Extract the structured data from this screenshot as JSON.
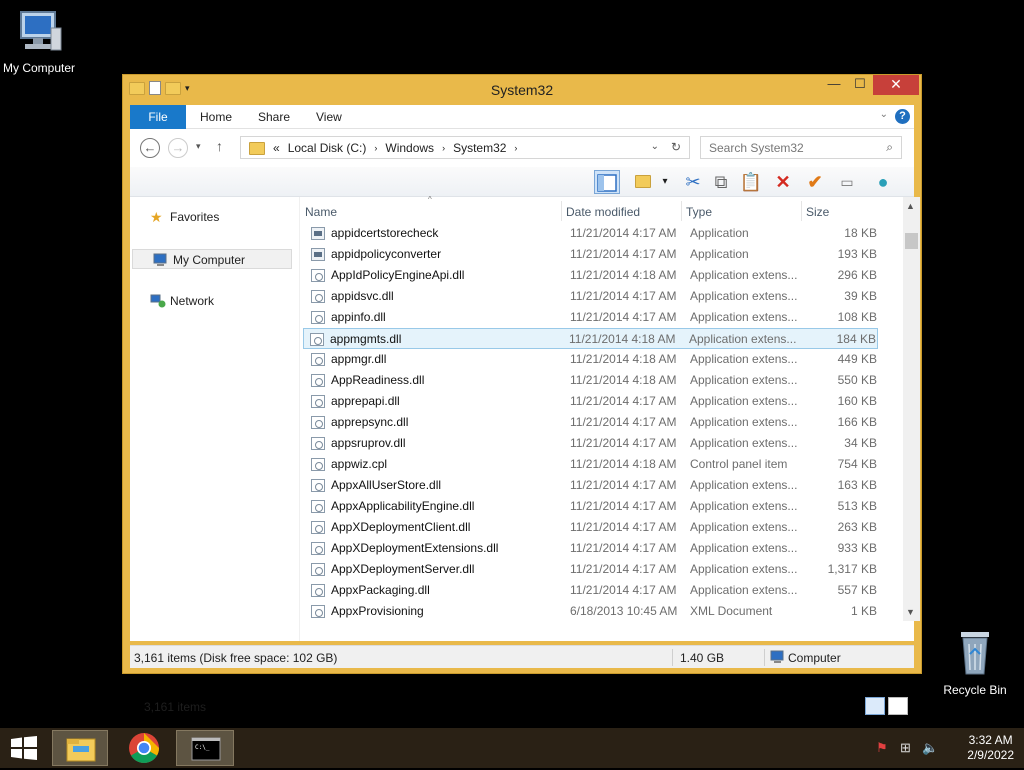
{
  "desktop": {
    "my_computer": "My Computer",
    "recycle_bin": "Recycle Bin"
  },
  "window": {
    "title": "System32",
    "ribbon_tabs": [
      "File",
      "Home",
      "Share",
      "View"
    ],
    "address": {
      "prefix": "«",
      "crumbs": [
        "Local Disk (C:)",
        "Windows",
        "System32"
      ]
    },
    "search_placeholder": "Search System32",
    "nav": {
      "favorites": "Favorites",
      "my_computer": "My Computer",
      "network": "Network"
    },
    "columns": {
      "name": "Name",
      "date": "Date modified",
      "type": "Type",
      "size": "Size"
    },
    "files": [
      {
        "name": "appidcertstorecheck",
        "date": "11/21/2014 4:17 AM",
        "type": "Application",
        "size": "18 KB",
        "icon": "app"
      },
      {
        "name": "appidpolicyconverter",
        "date": "11/21/2014 4:17 AM",
        "type": "Application",
        "size": "193 KB",
        "icon": "app"
      },
      {
        "name": "AppIdPolicyEngineApi.dll",
        "date": "11/21/2014 4:18 AM",
        "type": "Application extens...",
        "size": "296 KB",
        "icon": "dll"
      },
      {
        "name": "appidsvc.dll",
        "date": "11/21/2014 4:17 AM",
        "type": "Application extens...",
        "size": "39 KB",
        "icon": "dll"
      },
      {
        "name": "appinfo.dll",
        "date": "11/21/2014 4:17 AM",
        "type": "Application extens...",
        "size": "108 KB",
        "icon": "dll"
      },
      {
        "name": "appmgmts.dll",
        "date": "11/21/2014 4:18 AM",
        "type": "Application extens...",
        "size": "184 KB",
        "icon": "dll"
      },
      {
        "name": "appmgr.dll",
        "date": "11/21/2014 4:18 AM",
        "type": "Application extens...",
        "size": "449 KB",
        "icon": "dll"
      },
      {
        "name": "AppReadiness.dll",
        "date": "11/21/2014 4:18 AM",
        "type": "Application extens...",
        "size": "550 KB",
        "icon": "dll"
      },
      {
        "name": "apprepapi.dll",
        "date": "11/21/2014 4:17 AM",
        "type": "Application extens...",
        "size": "160 KB",
        "icon": "dll"
      },
      {
        "name": "apprepsync.dll",
        "date": "11/21/2014 4:17 AM",
        "type": "Application extens...",
        "size": "166 KB",
        "icon": "dll"
      },
      {
        "name": "appsruprov.dll",
        "date": "11/21/2014 4:17 AM",
        "type": "Application extens...",
        "size": "34 KB",
        "icon": "dll"
      },
      {
        "name": "appwiz.cpl",
        "date": "11/21/2014 4:18 AM",
        "type": "Control panel item",
        "size": "754 KB",
        "icon": "dll"
      },
      {
        "name": "AppxAllUserStore.dll",
        "date": "11/21/2014 4:17 AM",
        "type": "Application extens...",
        "size": "163 KB",
        "icon": "dll"
      },
      {
        "name": "AppxApplicabilityEngine.dll",
        "date": "11/21/2014 4:17 AM",
        "type": "Application extens...",
        "size": "513 KB",
        "icon": "dll"
      },
      {
        "name": "AppXDeploymentClient.dll",
        "date": "11/21/2014 4:17 AM",
        "type": "Application extens...",
        "size": "263 KB",
        "icon": "dll"
      },
      {
        "name": "AppXDeploymentExtensions.dll",
        "date": "11/21/2014 4:17 AM",
        "type": "Application extens...",
        "size": "933 KB",
        "icon": "dll"
      },
      {
        "name": "AppXDeploymentServer.dll",
        "date": "11/21/2014 4:17 AM",
        "type": "Application extens...",
        "size": "1,317 KB",
        "icon": "dll"
      },
      {
        "name": "AppxPackaging.dll",
        "date": "11/21/2014 4:17 AM",
        "type": "Application extens...",
        "size": "557 KB",
        "icon": "dll"
      },
      {
        "name": "AppxProvisioning",
        "date": "6/18/2013 10:45 AM",
        "type": "XML Document",
        "size": "1 KB",
        "icon": "xml"
      }
    ],
    "selected_index": 5,
    "items_count": "3,161 items",
    "status": {
      "left": "3,161 items (Disk free space: 102 GB)",
      "size": "1.40 GB",
      "location": "Computer"
    }
  },
  "taskbar": {
    "time": "3:32 AM",
    "date": "2/9/2022"
  }
}
